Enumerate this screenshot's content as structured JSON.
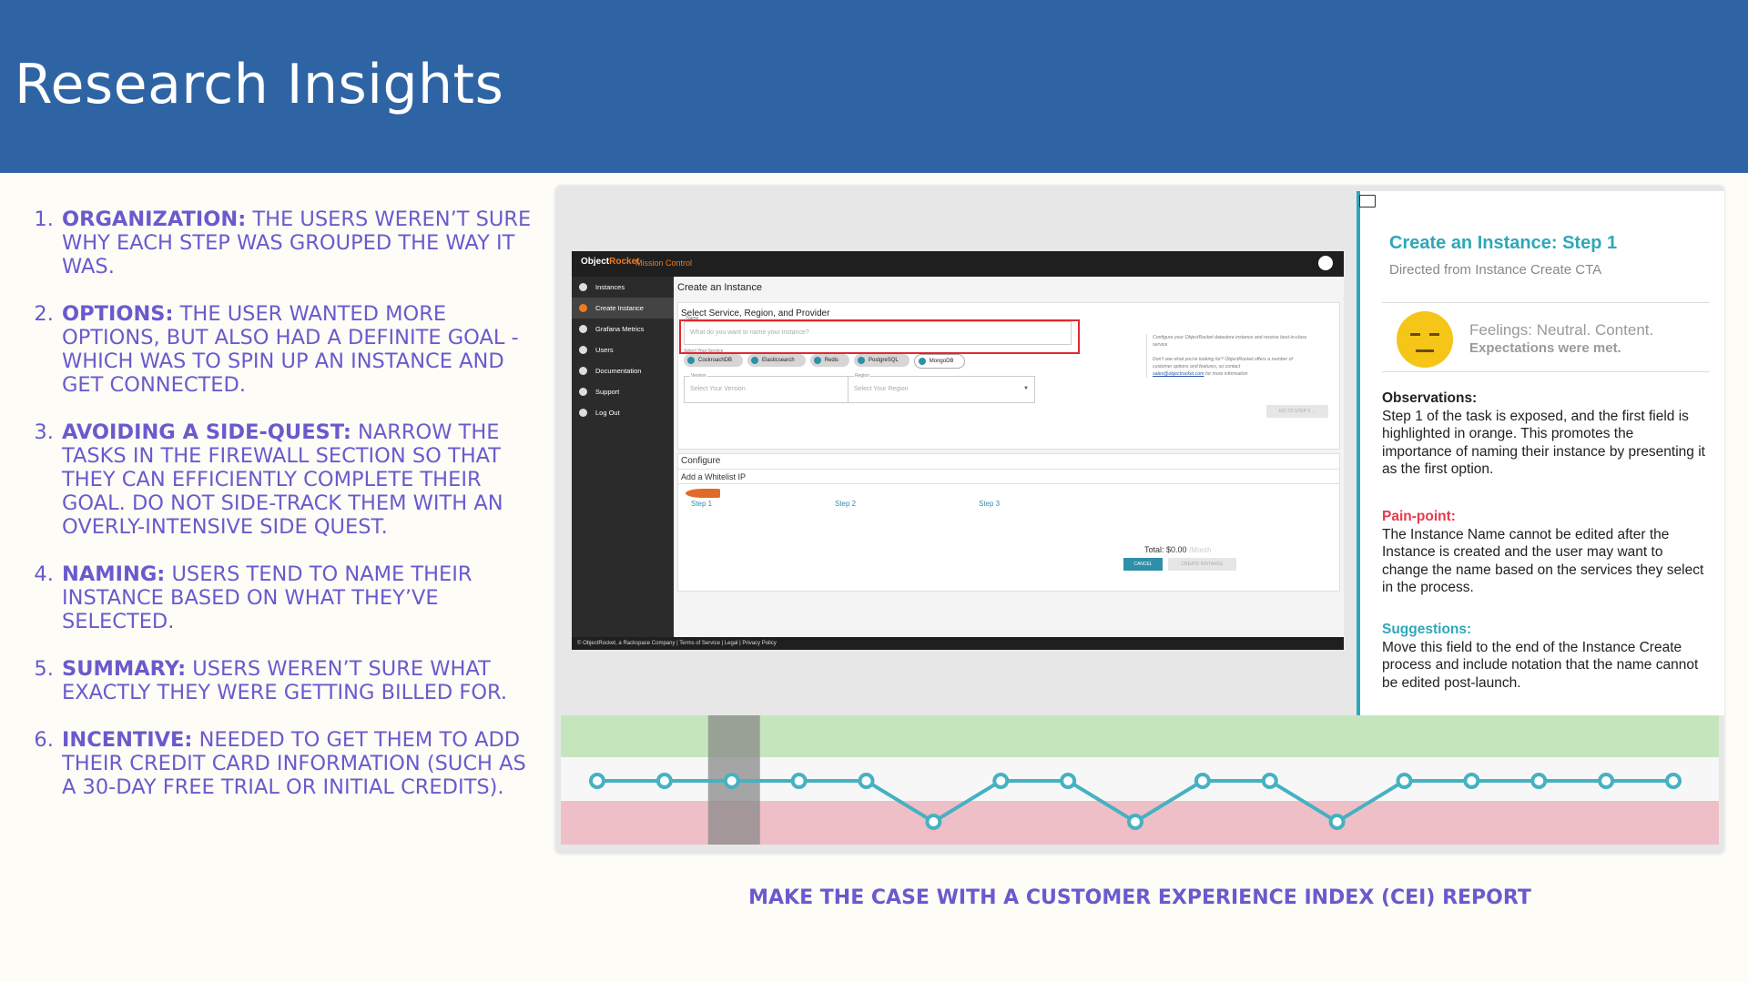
{
  "title": "Research Insights",
  "insights": [
    {
      "label": "Organization:",
      "text": "The users weren’t sure why each step was grouped the way it was."
    },
    {
      "label": "Options:",
      "text": "The user wanted more options, but also had a definite goal - which was to spin up an instance and get connected."
    },
    {
      "label": "Avoiding a side-quest:",
      "text": "Narrow the tasks in the firewall section so that they can efficiently complete their goal. Do not side-track them with an overly-intensive side quest."
    },
    {
      "label": "Naming:",
      "text": "Users tend to name their instance based on what they’ve selected."
    },
    {
      "label": "Summary:",
      "text": "Users weren’t sure what exactly they were getting billed for."
    },
    {
      "label": "Incentive:",
      "text": "Needed to get them to add their credit card information (such as a 30-day free trial or initial credits)."
    }
  ],
  "app": {
    "logo_a": "Object",
    "logo_b": "Rocket",
    "product": "Mission Control",
    "sidebar": [
      "Instances",
      "Create Instance",
      "Grafana Metrics",
      "Users",
      "Documentation",
      "Support",
      "Log Out"
    ],
    "page_title": "Create an Instance",
    "section_title": "Select Service, Region, and Provider",
    "name_label": "Name",
    "name_placeholder": "What do you want to name your instance?",
    "service_label": "Select Your Service",
    "services": [
      "CockroachDB",
      "Elasticsearch",
      "Redis",
      "PostgreSQL",
      "MongoDB"
    ],
    "version_label": "Version",
    "version_placeholder": "Select Your Version",
    "region_label": "Region",
    "region_placeholder": "Select Your Region",
    "note1": "Configure your ObjectRocket datastore instance and receive best-in-class service",
    "note2": "Don't see what you're looking for? ObjectRocket offers a number of customer options and features, so contact",
    "note_email": "sales@objectrocket.com",
    "note3": "for more information",
    "step_btn": "GO TO STEP 2 →",
    "configure": "Configure",
    "whitelist": "Add a Whitelist IP",
    "steps": [
      "Step 1",
      "Step 2",
      "Step 3"
    ],
    "total": "Total: $0.00",
    "per": "/Month",
    "cancel": "CANCEL",
    "create": "CREATE INSTANCE",
    "footer": "© ObjectRocket, a Rackspace Company | Terms of Service | Legal | Privacy Policy"
  },
  "findings": {
    "title": "Create an Instance: Step 1",
    "subtitle": "Directed from Instance Create CTA",
    "feeling_line1": "Feelings: Neutral. Content.",
    "feeling_line2": "Expectations were met.",
    "obs_head": "Observations:",
    "obs_text": "Step 1 of the task is exposed, and the first field is highlighted in orange. This promotes the importance of naming their instance by presenting it as the first option.",
    "pain_head": "Pain-point:",
    "pain_text": "The Instance Name cannot be edited after the Instance is created and the user may want to change the name based on the services they select in the process.",
    "sugg_head": "Suggestions:",
    "sugg_text": "Move this field to the end of the Instance Create process and include notation that the name cannot be edited post-launch."
  },
  "cei": {
    "levels": [
      0,
      0,
      0,
      0,
      0,
      -1,
      0,
      0,
      -1,
      0,
      0,
      -1,
      0,
      0,
      0,
      0,
      0
    ],
    "highlight_index": 2,
    "colors": {
      "positive": "#c5e6bd",
      "neutral": "#f7f7f7",
      "negative": "#efbfc8",
      "line": "#46b1c1",
      "highlight": "#8a8a8a"
    }
  },
  "caption": "Make the case with a Customer Experience Index (CEI) report"
}
